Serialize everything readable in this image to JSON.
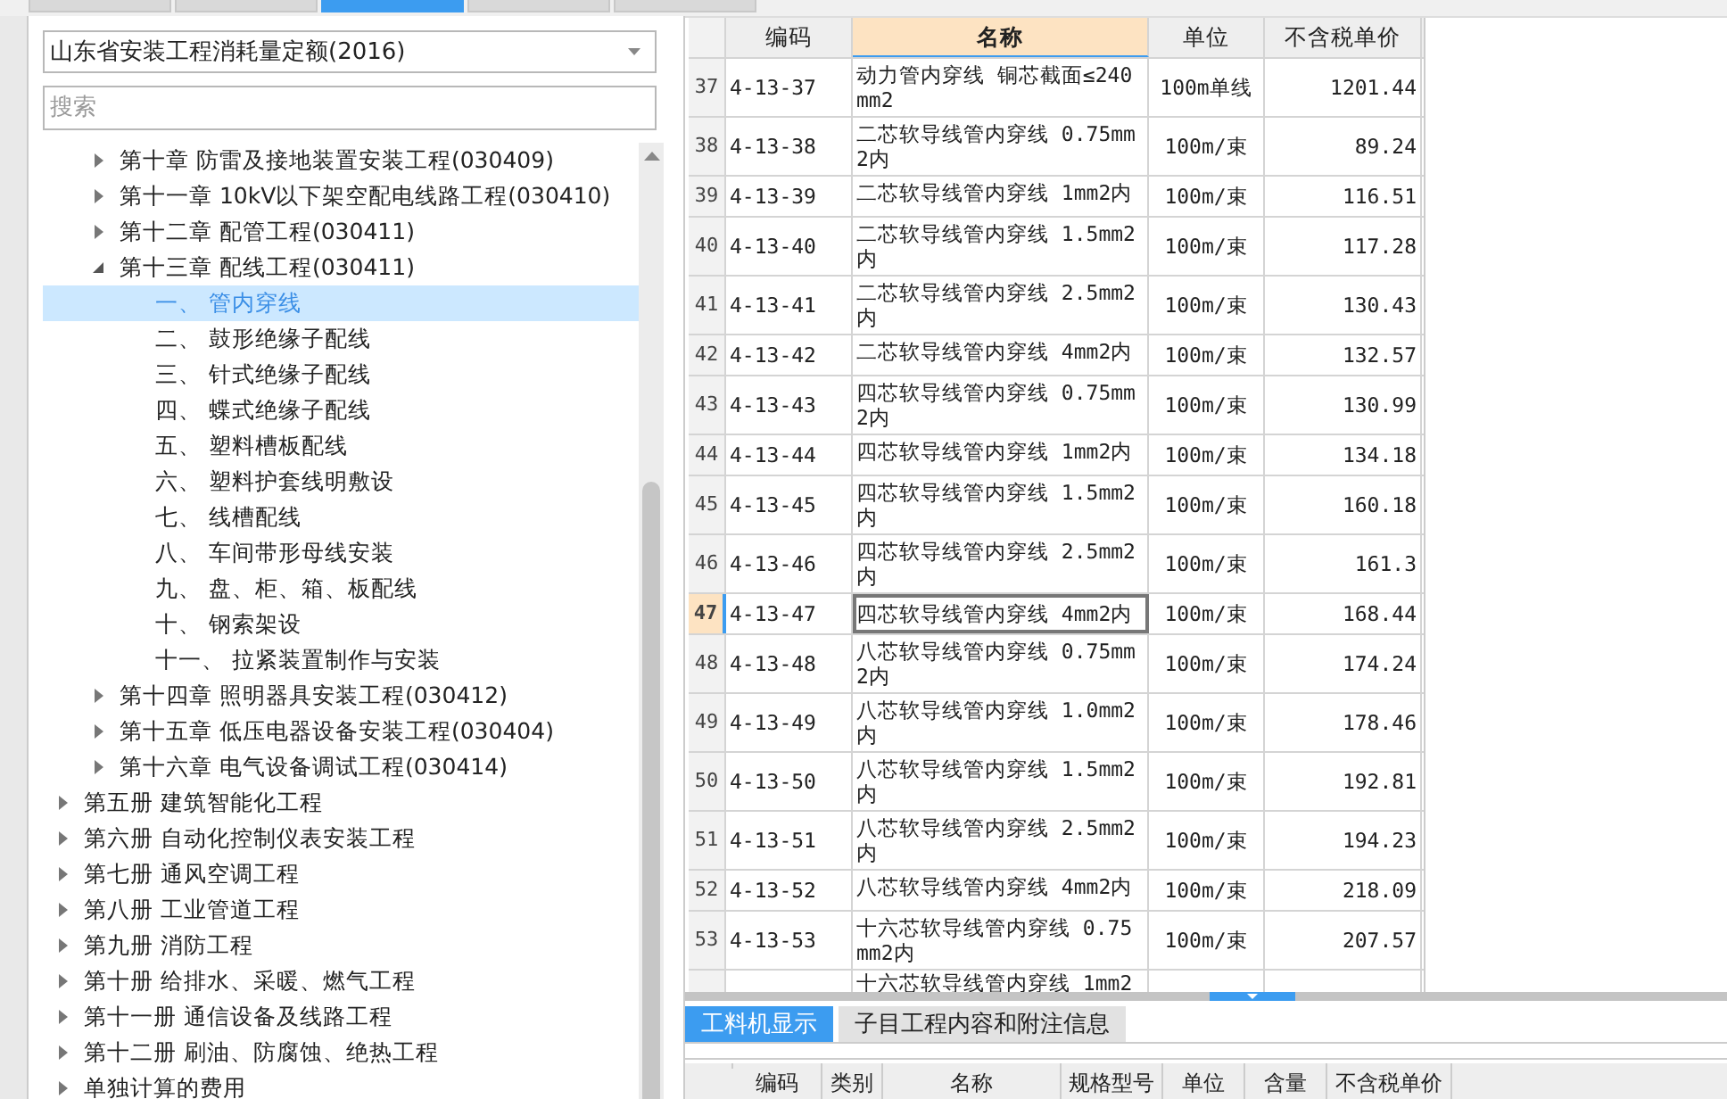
{
  "top_tabs": [
    {
      "selected": false
    },
    {
      "selected": false
    },
    {
      "selected": true
    },
    {
      "selected": false
    },
    {
      "selected": false
    }
  ],
  "library_select": {
    "value": "山东省安装工程消耗量定额(2016)"
  },
  "search": {
    "placeholder": "搜索"
  },
  "tree": {
    "chapters": [
      {
        "label": "第十章 防雷及接地装置安装工程(030409)",
        "expanded": false
      },
      {
        "label": "第十一章 10kV以下架空配电线路工程(030410)",
        "expanded": false
      },
      {
        "label": "第十二章 配管工程(030411)",
        "expanded": false
      },
      {
        "label": "第十三章 配线工程(030411)",
        "expanded": true,
        "children": [
          {
            "label": "一、 管内穿线",
            "selected": true
          },
          {
            "label": "二、 鼓形绝缘子配线",
            "selected": false
          },
          {
            "label": "三、 针式绝缘子配线",
            "selected": false
          },
          {
            "label": "四、 蝶式绝缘子配线",
            "selected": false
          },
          {
            "label": "五、 塑料槽板配线",
            "selected": false
          },
          {
            "label": "六、 塑料护套线明敷设",
            "selected": false
          },
          {
            "label": "七、 线槽配线",
            "selected": false
          },
          {
            "label": "八、 车间带形母线安装",
            "selected": false
          },
          {
            "label": "九、 盘、柜、箱、板配线",
            "selected": false
          },
          {
            "label": "十、 钢索架设",
            "selected": false
          },
          {
            "label": "十一、 拉紧装置制作与安装",
            "selected": false
          }
        ]
      },
      {
        "label": "第十四章 照明器具安装工程(030412)",
        "expanded": false
      },
      {
        "label": "第十五章 低压电器设备安装工程(030404)",
        "expanded": false
      },
      {
        "label": "第十六章 电气设备调试工程(030414)",
        "expanded": false
      }
    ],
    "books": [
      {
        "label": "第五册 建筑智能化工程",
        "expanded": false
      },
      {
        "label": "第六册 自动化控制仪表安装工程",
        "expanded": false
      },
      {
        "label": "第七册 通风空调工程",
        "expanded": false
      },
      {
        "label": "第八册 工业管道工程",
        "expanded": false
      },
      {
        "label": "第九册 消防工程",
        "expanded": false
      },
      {
        "label": "第十册 给排水、采暖、燃气工程",
        "expanded": false
      },
      {
        "label": "第十一册 通信设备及线路工程",
        "expanded": false
      },
      {
        "label": "第十二册 刷油、防腐蚀、绝热工程",
        "expanded": false
      },
      {
        "label": "单独计算的费用",
        "expanded": false
      }
    ]
  },
  "table": {
    "columns": [
      {
        "label": "编码",
        "selected": false
      },
      {
        "label": "名称",
        "selected": true
      },
      {
        "label": "单位",
        "selected": false
      },
      {
        "label": "不含税单价",
        "selected": false
      }
    ],
    "rows": [
      {
        "num": "37",
        "code": "4-13-37",
        "name": "动力管内穿线 铜芯截面≤240mm2",
        "unit": "100m单线",
        "price": "1201.44",
        "selected": false
      },
      {
        "num": "38",
        "code": "4-13-38",
        "name": "二芯软导线管内穿线 0.75mm2内",
        "unit": "100m/束",
        "price": "89.24",
        "selected": false
      },
      {
        "num": "39",
        "code": "4-13-39",
        "name": "二芯软导线管内穿线 1mm2内",
        "unit": "100m/束",
        "price": "116.51",
        "selected": false
      },
      {
        "num": "40",
        "code": "4-13-40",
        "name": "二芯软导线管内穿线 1.5mm2内",
        "unit": "100m/束",
        "price": "117.28",
        "selected": false
      },
      {
        "num": "41",
        "code": "4-13-41",
        "name": "二芯软导线管内穿线 2.5mm2内",
        "unit": "100m/束",
        "price": "130.43",
        "selected": false
      },
      {
        "num": "42",
        "code": "4-13-42",
        "name": "二芯软导线管内穿线 4mm2内",
        "unit": "100m/束",
        "price": "132.57",
        "selected": false
      },
      {
        "num": "43",
        "code": "4-13-43",
        "name": "四芯软导线管内穿线 0.75mm2内",
        "unit": "100m/束",
        "price": "130.99",
        "selected": false
      },
      {
        "num": "44",
        "code": "4-13-44",
        "name": "四芯软导线管内穿线 1mm2内",
        "unit": "100m/束",
        "price": "134.18",
        "selected": false
      },
      {
        "num": "45",
        "code": "4-13-45",
        "name": "四芯软导线管内穿线 1.5mm2内",
        "unit": "100m/束",
        "price": "160.18",
        "selected": false
      },
      {
        "num": "46",
        "code": "4-13-46",
        "name": "四芯软导线管内穿线 2.5mm2内",
        "unit": "100m/束",
        "price": "161.3",
        "selected": false
      },
      {
        "num": "47",
        "code": "4-13-47",
        "name": "四芯软导线管内穿线 4mm2内",
        "unit": "100m/束",
        "price": "168.44",
        "selected": true
      },
      {
        "num": "48",
        "code": "4-13-48",
        "name": "八芯软导线管内穿线 0.75mm2内",
        "unit": "100m/束",
        "price": "174.24",
        "selected": false
      },
      {
        "num": "49",
        "code": "4-13-49",
        "name": "八芯软导线管内穿线 1.0mm2内",
        "unit": "100m/束",
        "price": "178.46",
        "selected": false
      },
      {
        "num": "50",
        "code": "4-13-50",
        "name": "八芯软导线管内穿线 1.5mm2内",
        "unit": "100m/束",
        "price": "192.81",
        "selected": false
      },
      {
        "num": "51",
        "code": "4-13-51",
        "name": "八芯软导线管内穿线 2.5mm2内",
        "unit": "100m/束",
        "price": "194.23",
        "selected": false
      },
      {
        "num": "52",
        "code": "4-13-52",
        "name": "八芯软导线管内穿线 4mm2内",
        "unit": "100m/束",
        "price": "218.09",
        "selected": false
      },
      {
        "num": "53",
        "code": "4-13-53",
        "name": "十六芯软导线管内穿线 0.75mm2内",
        "unit": "100m/束",
        "price": "207.57",
        "selected": false
      },
      {
        "name": "十六芯软导线管内穿线 1mm2",
        "selected": false
      }
    ]
  },
  "bottom_tabs": [
    {
      "label": "工料机显示",
      "selected": true
    },
    {
      "label": "子目工程内容和附注信息",
      "selected": false
    }
  ],
  "detail_table": {
    "columns": [
      "编码",
      "类别",
      "名称",
      "规格型号",
      "单位",
      "含量",
      "不含税单价"
    ]
  }
}
